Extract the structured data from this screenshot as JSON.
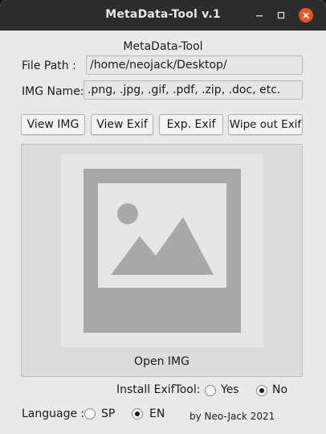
{
  "window": {
    "title": "MetaData-Tool v.1",
    "controls": {
      "minimize": "–",
      "close": "✕"
    }
  },
  "app": {
    "heading": "MetaData-Tool",
    "file_path": {
      "label": "File Path :",
      "value": "/home/neojack/Desktop/"
    },
    "img_name": {
      "label": "IMG Name:",
      "value": ".png, .jpg, .gif, .pdf, .zip, .doc, etc."
    },
    "buttons": {
      "view_img": "View IMG",
      "view_exif": "View Exif",
      "exp_exif": "Exp. Exif",
      "wipe_exif": "Wipe out Exif"
    },
    "preview": {
      "caption": "Open IMG",
      "icon": "image-placeholder-icon"
    },
    "install": {
      "label": "Install ExifTool:",
      "options": [
        "Yes",
        "No"
      ],
      "selected": "No"
    },
    "language": {
      "label": "Language :",
      "options": [
        "SP",
        "EN"
      ],
      "selected": "EN"
    },
    "credit": "by Neo-Jack 2021"
  },
  "colors": {
    "titlebar": "#2c2c2c",
    "close_button": "#e95420",
    "window_bg": "#e9e9e9",
    "placeholder_dark": "#a9a9a9",
    "placeholder_light": "#e6e6e6"
  }
}
